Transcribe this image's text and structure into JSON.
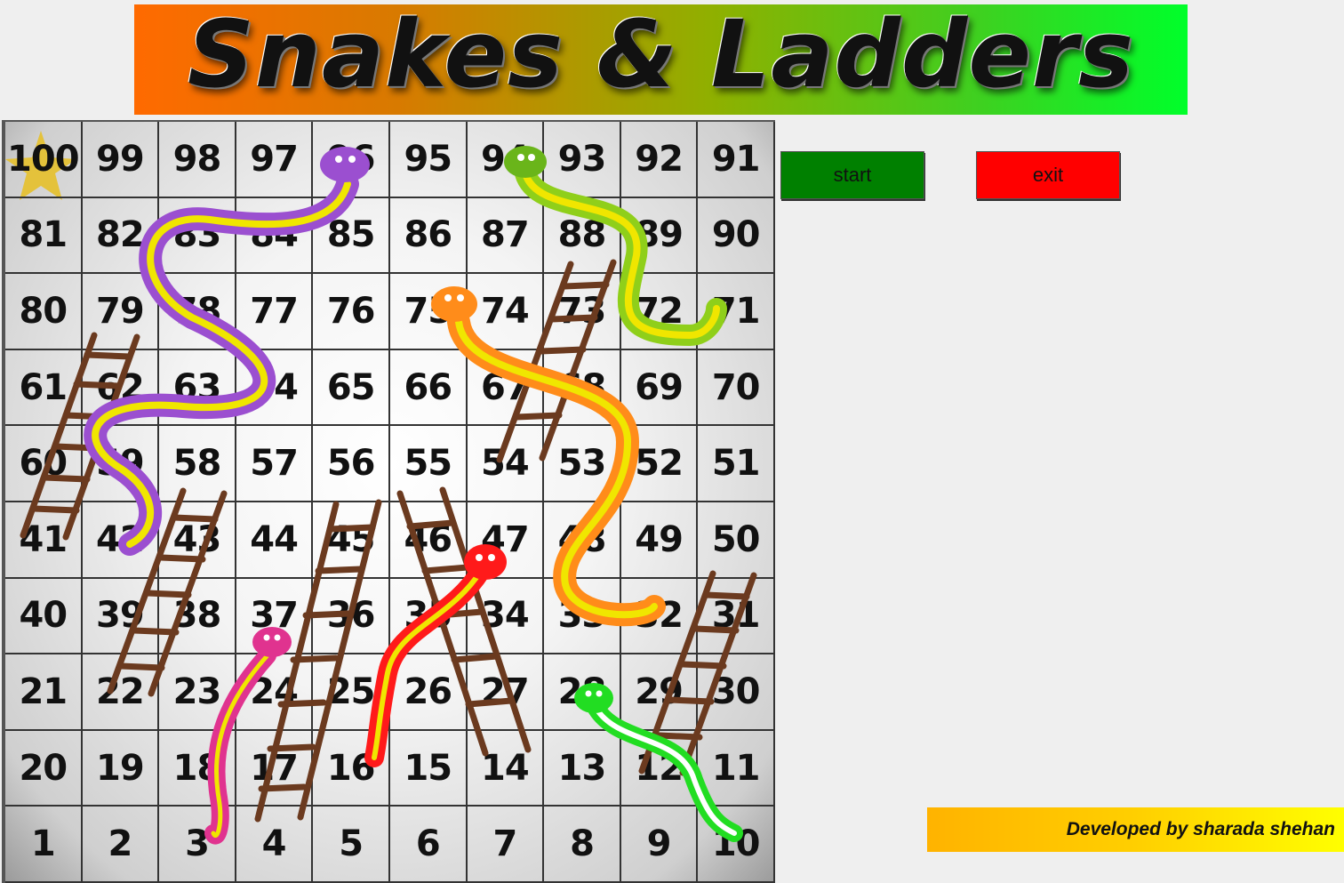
{
  "banner": {
    "title": "Snakes & Ladders"
  },
  "board": {
    "rows": [
      [
        100,
        99,
        98,
        97,
        96,
        95,
        94,
        93,
        92,
        91
      ],
      [
        81,
        82,
        83,
        84,
        85,
        86,
        87,
        88,
        89,
        90
      ],
      [
        80,
        79,
        78,
        77,
        76,
        75,
        74,
        73,
        72,
        71
      ],
      [
        61,
        62,
        63,
        64,
        65,
        66,
        67,
        68,
        69,
        70
      ],
      [
        60,
        59,
        58,
        57,
        56,
        55,
        54,
        53,
        52,
        51
      ],
      [
        41,
        42,
        43,
        44,
        45,
        46,
        47,
        48,
        49,
        50
      ],
      [
        40,
        39,
        38,
        37,
        36,
        35,
        34,
        33,
        32,
        31
      ],
      [
        21,
        22,
        23,
        24,
        25,
        26,
        27,
        28,
        29,
        30
      ],
      [
        20,
        19,
        18,
        17,
        16,
        15,
        14,
        13,
        12,
        11
      ],
      [
        1,
        2,
        3,
        4,
        5,
        6,
        7,
        8,
        9,
        10
      ]
    ],
    "star_icon": "star-icon",
    "snake_colors": [
      "#9b4fd0",
      "#8fcf1a",
      "#ff8c1a",
      "#ff1a1a",
      "#e0338f",
      "#22dd22"
    ],
    "ladder_color": "#6b3a1f"
  },
  "controls": {
    "start_label": "start",
    "exit_label": "exit"
  },
  "footer": {
    "credit": "Developed by sharada shehan"
  }
}
